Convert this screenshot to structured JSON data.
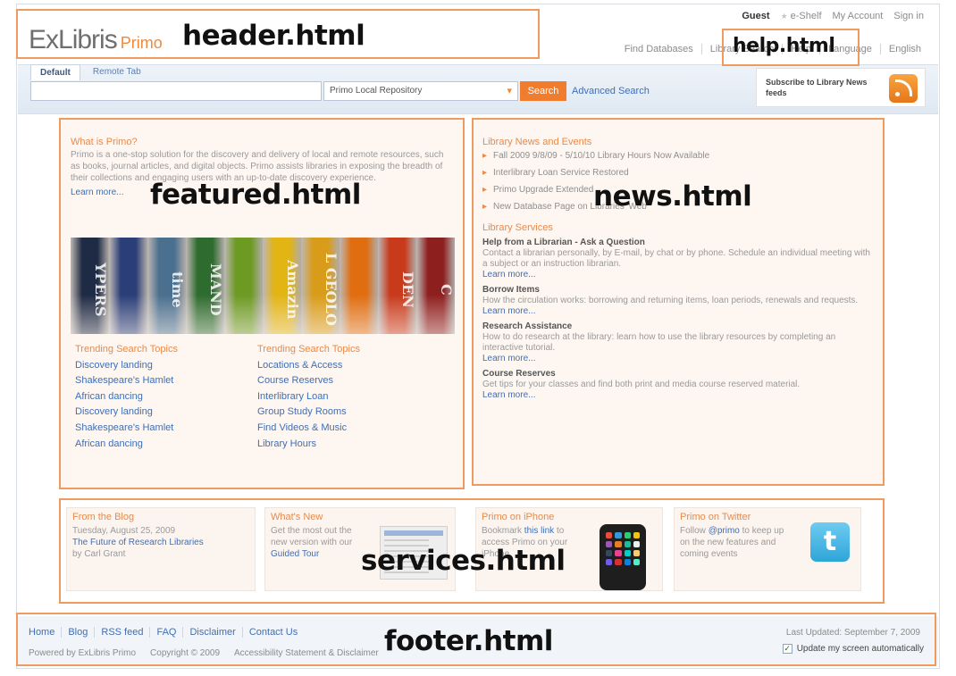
{
  "zones": {
    "header": "header.html",
    "help": "help.html",
    "featured": "featured.html",
    "news": "news.html",
    "services": "services.html",
    "footer": "footer.html"
  },
  "header": {
    "logo_text": "ExLibris",
    "logo_sub": "Primo",
    "user_links": [
      "Guest",
      "e-Shelf",
      "My Account",
      "Sign in"
    ],
    "nav_links": [
      "Find Databases",
      "Library Search",
      "Help",
      "Language",
      "English"
    ]
  },
  "search": {
    "tabs": [
      "Default",
      "Remote Tab"
    ],
    "scope_selected": "Primo Local Repository",
    "button_label": "Search",
    "advanced_label": "Advanced Search",
    "rss_text": "Subscribe to Library News feeds"
  },
  "featured": {
    "title": "What is Primo?",
    "description": "Primo is a one-stop solution for the discovery and delivery of local and remote resources, such as books, journal articles, and digital objects. Primo assists libraries in exposing the breadth of their collections and engaging users with an up-to-date discovery experience.",
    "learn_more": "Learn more...",
    "book_spines": [
      "YPERS",
      "",
      "time",
      "MAND",
      "",
      "Amazin",
      "L GEOLO",
      "",
      "DEN",
      "C"
    ],
    "topics_left_heading": "Trending Search Topics",
    "topics_left": [
      "Discovery landing",
      "Shakespeare's Hamlet",
      "African dancing",
      "Discovery landing",
      "Shakespeare's Hamlet",
      "African dancing"
    ],
    "topics_right_heading": "Trending Search Topics",
    "topics_right": [
      "Locations & Access",
      "Course Reserves",
      "Interlibrary Loan",
      "Group Study Rooms",
      "Find Videos & Music",
      "Library Hours"
    ]
  },
  "news": {
    "title": "Library News and Events",
    "items": [
      "Fall 2009 9/8/09 - 5/10/10 Library Hours Now Available",
      "Interlibrary Loan Service Restored",
      "Primo Upgrade Extended",
      "New Database Page on Libraries' Web"
    ],
    "services_title": "Library Services",
    "services": [
      {
        "title": "Help from a Librarian - Ask a Question",
        "desc": "Contact a librarian personally, by E-mail, by chat or by phone. Schedule an individual meeting with a subject or an instruction librarian.",
        "link": "Learn more..."
      },
      {
        "title": "Borrow Items",
        "desc": "How the circulation works: borrowing and returning items, loan periods, renewals and requests.",
        "link": "Learn more..."
      },
      {
        "title": "Research Assistance",
        "desc": "How to do research at the library: learn how to use the library resources by completing an interactive tutorial.",
        "link": "Learn more..."
      },
      {
        "title": "Course Reserves",
        "desc": "Get tips for your classes and find both print and media course reserved material.",
        "link": "Learn more..."
      }
    ]
  },
  "services": {
    "blog": {
      "title": "From the Blog",
      "date": "Tuesday, August 25, 2009",
      "link": "The Future of Research Libraries",
      "author": "by Carl Grant"
    },
    "whatsnew": {
      "title": "What's New",
      "body": "Get the most out the new version with our",
      "link": "Guided Tour"
    },
    "iphone": {
      "title": "Primo on iPhone",
      "body_pre": "Bookmark",
      "link": "this link",
      "body_post": "to access Primo on your iPhone"
    },
    "twitter": {
      "title": "Primo on Twitter",
      "body_pre": "Follow",
      "link": "@primo",
      "body_post": "to keep up on the new features and coming events"
    }
  },
  "footer": {
    "links": [
      "Home",
      "Blog",
      "RSS feed",
      "FAQ",
      "Disclaimer",
      "Contact Us"
    ],
    "legal": [
      "Powered by ExLibris Primo",
      "Copyright © 2009",
      "Accessibility Statement & Disclaimer"
    ],
    "updated": "Last Updated: September 7, 2009",
    "auto_update": "Update my screen automatically"
  },
  "colors": {
    "zone_border": "#ef9a5f",
    "accent_orange": "#f07d2e",
    "link_blue": "#3f6fb6",
    "book_colors": [
      "#1f2a44",
      "#2a3e78",
      "#4a6f8f",
      "#2e6b2e",
      "#6c9a23",
      "#e2b414",
      "#d99c1a",
      "#e06d10",
      "#c83a1c",
      "#8e1f1f"
    ]
  }
}
